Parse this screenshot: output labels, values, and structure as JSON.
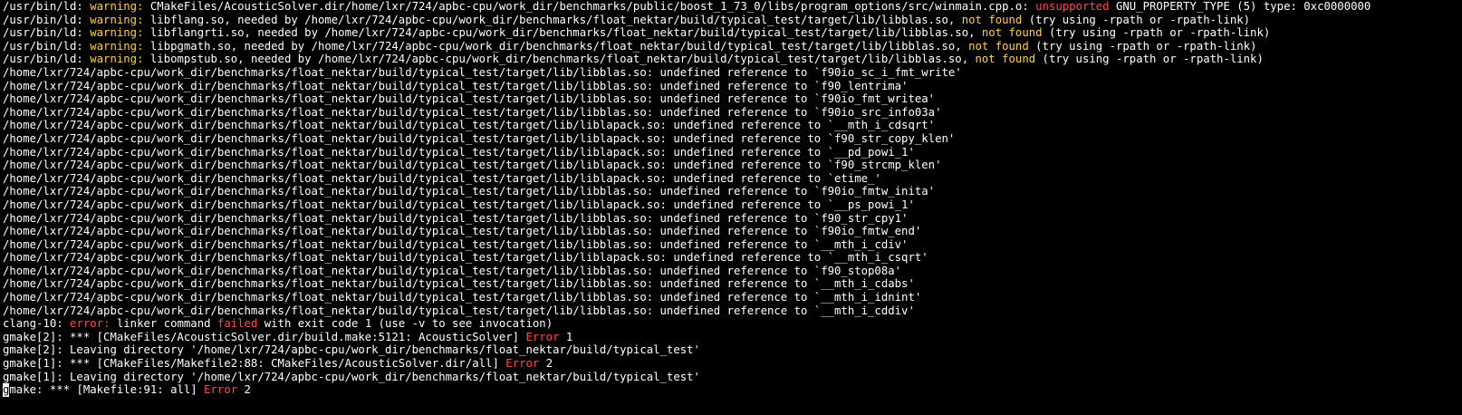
{
  "colors": {
    "background": "#000000",
    "text": "#ffffff",
    "warning": "#ffd23c",
    "error": "#ff4b4b"
  },
  "terminal": {
    "lines": [
      [
        {
          "t": "/usr/bin/ld: "
        },
        {
          "t": "warning:",
          "c": "warning"
        },
        {
          "t": " CMakeFiles/AcousticSolver.dir/home/lxr/724/apbc-cpu/work_dir/benchmarks/public/boost_1_73_0/libs/program_options/src/winmain.cpp.o: "
        },
        {
          "t": "unsupported",
          "c": "error"
        },
        {
          "t": " GNU_PROPERTY_TYPE (5) type: 0xc0000000"
        }
      ],
      [
        {
          "t": "/usr/bin/ld: "
        },
        {
          "t": "warning:",
          "c": "warning"
        },
        {
          "t": " libflang.so, needed by /home/lxr/724/apbc-cpu/work_dir/benchmarks/float_nektar/build/typical_test/target/lib/libblas.so, "
        },
        {
          "t": "not found",
          "c": "warning"
        },
        {
          "t": " (try using -rpath or -rpath-link)"
        }
      ],
      [
        {
          "t": "/usr/bin/ld: "
        },
        {
          "t": "warning:",
          "c": "warning"
        },
        {
          "t": " libflangrti.so, needed by /home/lxr/724/apbc-cpu/work_dir/benchmarks/float_nektar/build/typical_test/target/lib/libblas.so, "
        },
        {
          "t": "not found",
          "c": "warning"
        },
        {
          "t": " (try using -rpath or -rpath-link)"
        }
      ],
      [
        {
          "t": "/usr/bin/ld: "
        },
        {
          "t": "warning:",
          "c": "warning"
        },
        {
          "t": " libpgmath.so, needed by /home/lxr/724/apbc-cpu/work_dir/benchmarks/float_nektar/build/typical_test/target/lib/libblas.so, "
        },
        {
          "t": "not found",
          "c": "warning"
        },
        {
          "t": " (try using -rpath or -rpath-link)"
        }
      ],
      [
        {
          "t": "/usr/bin/ld: "
        },
        {
          "t": "warning:",
          "c": "warning"
        },
        {
          "t": " libompstub.so, needed by /home/lxr/724/apbc-cpu/work_dir/benchmarks/float_nektar/build/typical_test/target/lib/libblas.so, "
        },
        {
          "t": "not found",
          "c": "warning"
        },
        {
          "t": " (try using -rpath or -rpath-link)"
        }
      ],
      [
        {
          "t": "/home/lxr/724/apbc-cpu/work_dir/benchmarks/float_nektar/build/typical_test/target/lib/libblas.so: undefined reference to `f90io_sc_i_fmt_write'"
        }
      ],
      [
        {
          "t": "/home/lxr/724/apbc-cpu/work_dir/benchmarks/float_nektar/build/typical_test/target/lib/libblas.so: undefined reference to `f90_lentrima'"
        }
      ],
      [
        {
          "t": "/home/lxr/724/apbc-cpu/work_dir/benchmarks/float_nektar/build/typical_test/target/lib/libblas.so: undefined reference to `f90io_fmt_writea'"
        }
      ],
      [
        {
          "t": "/home/lxr/724/apbc-cpu/work_dir/benchmarks/float_nektar/build/typical_test/target/lib/libblas.so: undefined reference to `f90io_src_info03a'"
        }
      ],
      [
        {
          "t": "/home/lxr/724/apbc-cpu/work_dir/benchmarks/float_nektar/build/typical_test/target/lib/liblapack.so: undefined reference to `__mth_i_cdsqrt'"
        }
      ],
      [
        {
          "t": "/home/lxr/724/apbc-cpu/work_dir/benchmarks/float_nektar/build/typical_test/target/lib/liblapack.so: undefined reference to `f90_str_copy_klen'"
        }
      ],
      [
        {
          "t": "/home/lxr/724/apbc-cpu/work_dir/benchmarks/float_nektar/build/typical_test/target/lib/liblapack.so: undefined reference to `__pd_powi_1'"
        }
      ],
      [
        {
          "t": "/home/lxr/724/apbc-cpu/work_dir/benchmarks/float_nektar/build/typical_test/target/lib/liblapack.so: undefined reference to `f90_strcmp_klen'"
        }
      ],
      [
        {
          "t": "/home/lxr/724/apbc-cpu/work_dir/benchmarks/float_nektar/build/typical_test/target/lib/liblapack.so: undefined reference to `etime_'"
        }
      ],
      [
        {
          "t": "/home/lxr/724/apbc-cpu/work_dir/benchmarks/float_nektar/build/typical_test/target/lib/libblas.so: undefined reference to `f90io_fmtw_inita'"
        }
      ],
      [
        {
          "t": "/home/lxr/724/apbc-cpu/work_dir/benchmarks/float_nektar/build/typical_test/target/lib/liblapack.so: undefined reference to `__ps_powi_1'"
        }
      ],
      [
        {
          "t": "/home/lxr/724/apbc-cpu/work_dir/benchmarks/float_nektar/build/typical_test/target/lib/libblas.so: undefined reference to `f90_str_cpy1'"
        }
      ],
      [
        {
          "t": "/home/lxr/724/apbc-cpu/work_dir/benchmarks/float_nektar/build/typical_test/target/lib/libblas.so: undefined reference to `f90io_fmtw_end'"
        }
      ],
      [
        {
          "t": "/home/lxr/724/apbc-cpu/work_dir/benchmarks/float_nektar/build/typical_test/target/lib/libblas.so: undefined reference to `__mth_i_cdiv'"
        }
      ],
      [
        {
          "t": "/home/lxr/724/apbc-cpu/work_dir/benchmarks/float_nektar/build/typical_test/target/lib/liblapack.so: undefined reference to `__mth_i_csqrt'"
        }
      ],
      [
        {
          "t": "/home/lxr/724/apbc-cpu/work_dir/benchmarks/float_nektar/build/typical_test/target/lib/libblas.so: undefined reference to `f90_stop08a'"
        }
      ],
      [
        {
          "t": "/home/lxr/724/apbc-cpu/work_dir/benchmarks/float_nektar/build/typical_test/target/lib/libblas.so: undefined reference to `__mth_i_cdabs'"
        }
      ],
      [
        {
          "t": "/home/lxr/724/apbc-cpu/work_dir/benchmarks/float_nektar/build/typical_test/target/lib/libblas.so: undefined reference to `__mth_i_idnint'"
        }
      ],
      [
        {
          "t": "/home/lxr/724/apbc-cpu/work_dir/benchmarks/float_nektar/build/typical_test/target/lib/libblas.so: undefined reference to `__mth_i_cddiv'"
        }
      ],
      [
        {
          "t": "clang-10: "
        },
        {
          "t": "error:",
          "c": "error"
        },
        {
          "t": " linker command "
        },
        {
          "t": "failed",
          "c": "error"
        },
        {
          "t": " with exit code 1 (use -v to see invocation)"
        }
      ],
      [
        {
          "t": "gmake[2]: *** [CMakeFiles/AcousticSolver.dir/build.make:5121: AcousticSolver] "
        },
        {
          "t": "Error",
          "c": "error"
        },
        {
          "t": " 1"
        }
      ],
      [
        {
          "t": "gmake[2]: Leaving directory '/home/lxr/724/apbc-cpu/work_dir/benchmarks/float_nektar/build/typical_test'"
        }
      ],
      [
        {
          "t": "gmake[1]: *** [CMakeFiles/Makefile2:88: CMakeFiles/AcousticSolver.dir/all] "
        },
        {
          "t": "Error",
          "c": "error"
        },
        {
          "t": " 2"
        }
      ],
      [
        {
          "t": "gmake[1]: Leaving directory '/home/lxr/724/apbc-cpu/work_dir/benchmarks/float_nektar/build/typical_test'"
        }
      ],
      [
        {
          "t": "g",
          "c": "cursor"
        },
        {
          "t": "make: *** [Makefile:91: all] "
        },
        {
          "t": "Error",
          "c": "error"
        },
        {
          "t": " 2"
        }
      ]
    ]
  }
}
